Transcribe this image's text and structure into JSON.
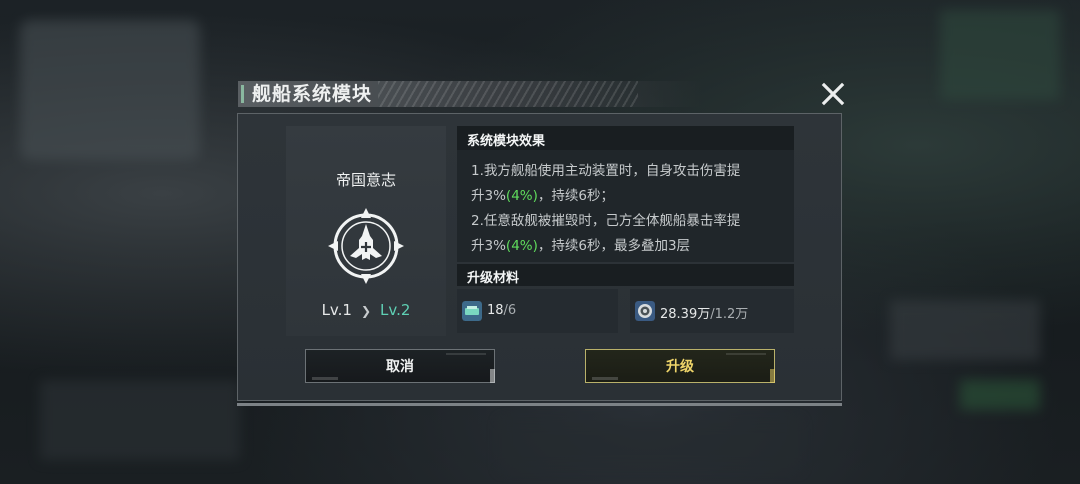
{
  "dialog": {
    "title": "舰船系统模块",
    "close_icon": "close-icon"
  },
  "module": {
    "name": "帝国意志",
    "emblem_icon": "crosshair-ship-emblem-icon",
    "level_current": "Lv.1",
    "level_next": "Lv.2"
  },
  "effects": {
    "title": "系统模块效果",
    "line1": "1.我方舰船使用主动装置时，自身攻击伤害提",
    "line2_a": "升3%",
    "line2_hl": "(4%)",
    "line2_b": "，持续6秒；",
    "line3": "2.任意敌舰被摧毁时，己方全体舰船暴击率提",
    "line4_a": "升3%",
    "line4_hl": "(4%)",
    "line4_b": "，持续6秒，最多叠加3层"
  },
  "materials": {
    "title": "升级材料",
    "items": [
      {
        "icon": "module-chip-icon",
        "have": "18",
        "need": "/6"
      },
      {
        "icon": "credit-coin-icon",
        "have": "28.39万",
        "need": "/1.2万"
      }
    ]
  },
  "buttons": {
    "cancel": "取消",
    "upgrade": "升级"
  },
  "colors": {
    "highlight": "#5fdc5c",
    "next_level": "#5fd0b4",
    "upgrade_text": "#f0d66a"
  }
}
